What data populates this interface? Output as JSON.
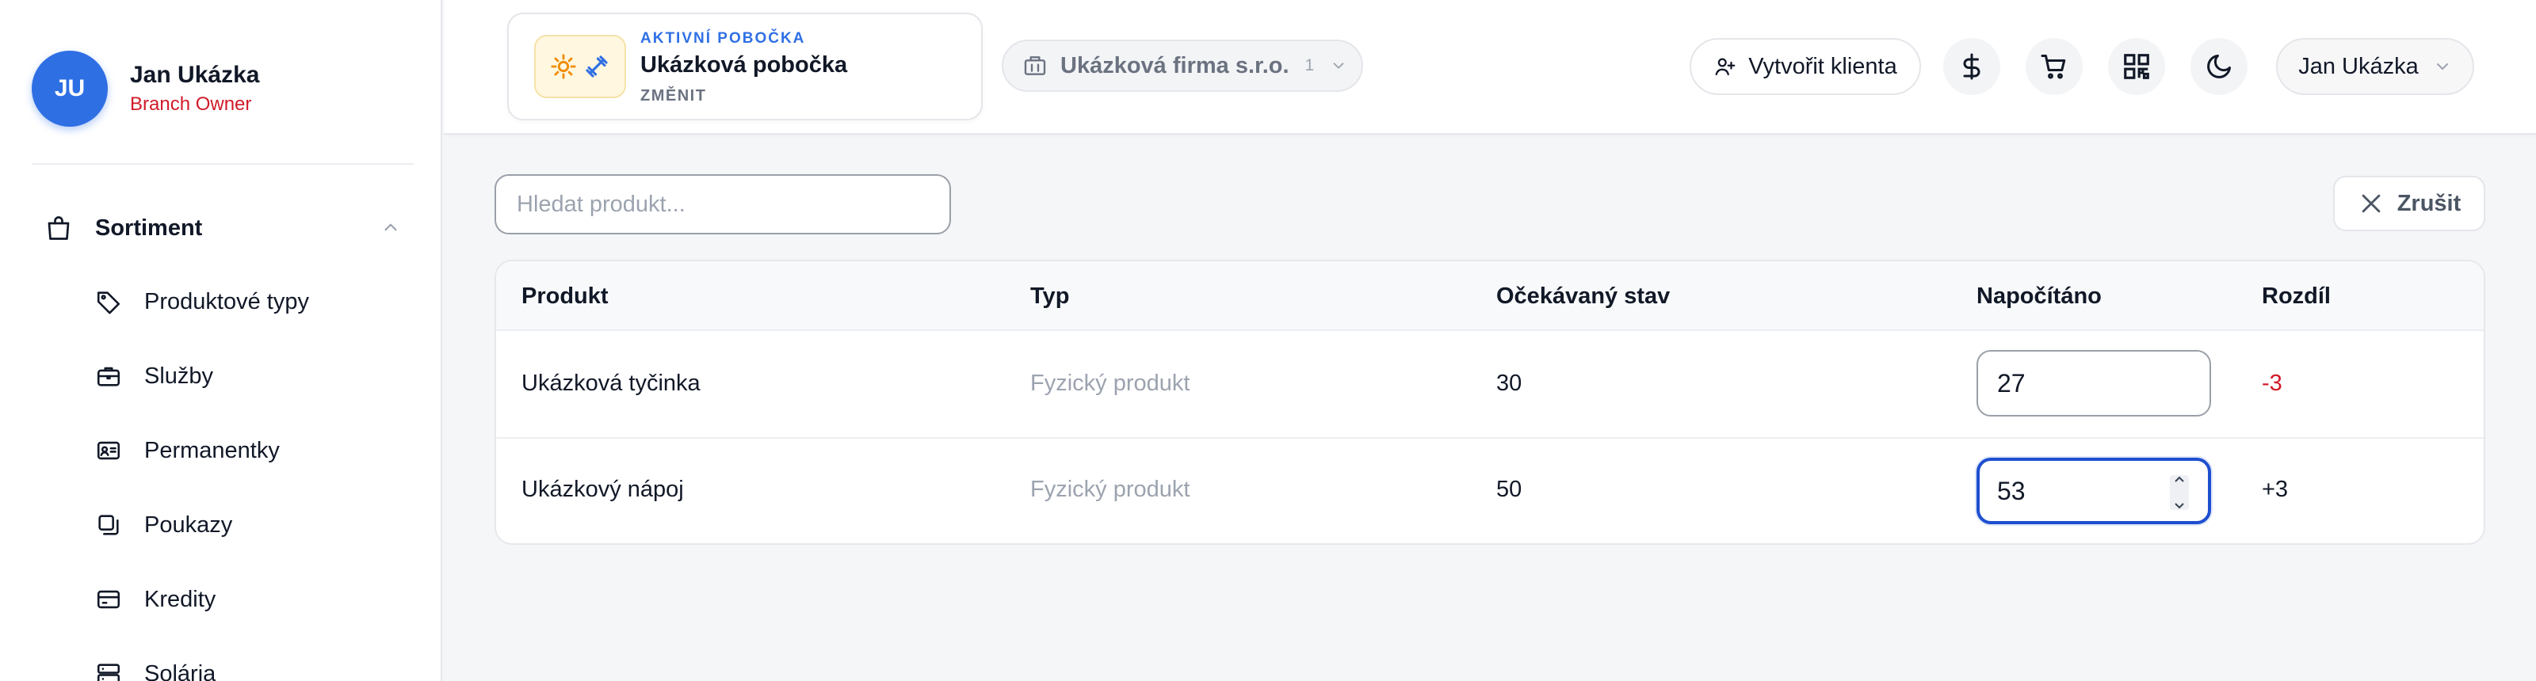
{
  "user": {
    "initials": "JU",
    "name": "Jan Ukázka",
    "role": "Branch Owner"
  },
  "sidebar": {
    "group": {
      "label": "Sortiment",
      "icon": "shopping-bag-icon",
      "expanded": true
    },
    "items": [
      {
        "label": "Produktové typy",
        "icon": "tag-icon"
      },
      {
        "label": "Služby",
        "icon": "briefcase-icon"
      },
      {
        "label": "Permanentky",
        "icon": "id-card-icon"
      },
      {
        "label": "Poukazy",
        "icon": "copy-icon"
      },
      {
        "label": "Kredity",
        "icon": "credit-card-icon"
      },
      {
        "label": "Solária",
        "icon": "server-icon"
      }
    ]
  },
  "header": {
    "branch": {
      "kicker": "AKTIVNÍ POBOČKA",
      "name": "Ukázková pobočka",
      "change_label": "ZMĚNIT"
    },
    "company": {
      "name": "Ukázková firma s.r.o.",
      "count": "1"
    },
    "create_client_label": "Vytvořit klienta",
    "icons": [
      "dollar-icon",
      "cart-icon",
      "qr-code-icon",
      "moon-icon"
    ],
    "user_menu_label": "Jan Ukázka"
  },
  "main": {
    "search": {
      "placeholder": "Hledat produkt...",
      "value": ""
    },
    "cancel_label": "Zrušit",
    "table": {
      "columns": [
        "Produkt",
        "Typ",
        "Očekávaný stav",
        "Napočítáno",
        "Rozdíl"
      ],
      "rows": [
        {
          "product": "Ukázková tyčinka",
          "type": "Fyzický produkt",
          "expected": "30",
          "counted": "27",
          "diff": "-3"
        },
        {
          "product": "Ukázkový nápoj",
          "type": "Fyzický produkt",
          "expected": "50",
          "counted": "53",
          "diff": "+3"
        }
      ]
    }
  },
  "colors": {
    "accent": "#2f6fe4",
    "negative": "#d11a2a",
    "focus": "#1e4fcf"
  }
}
